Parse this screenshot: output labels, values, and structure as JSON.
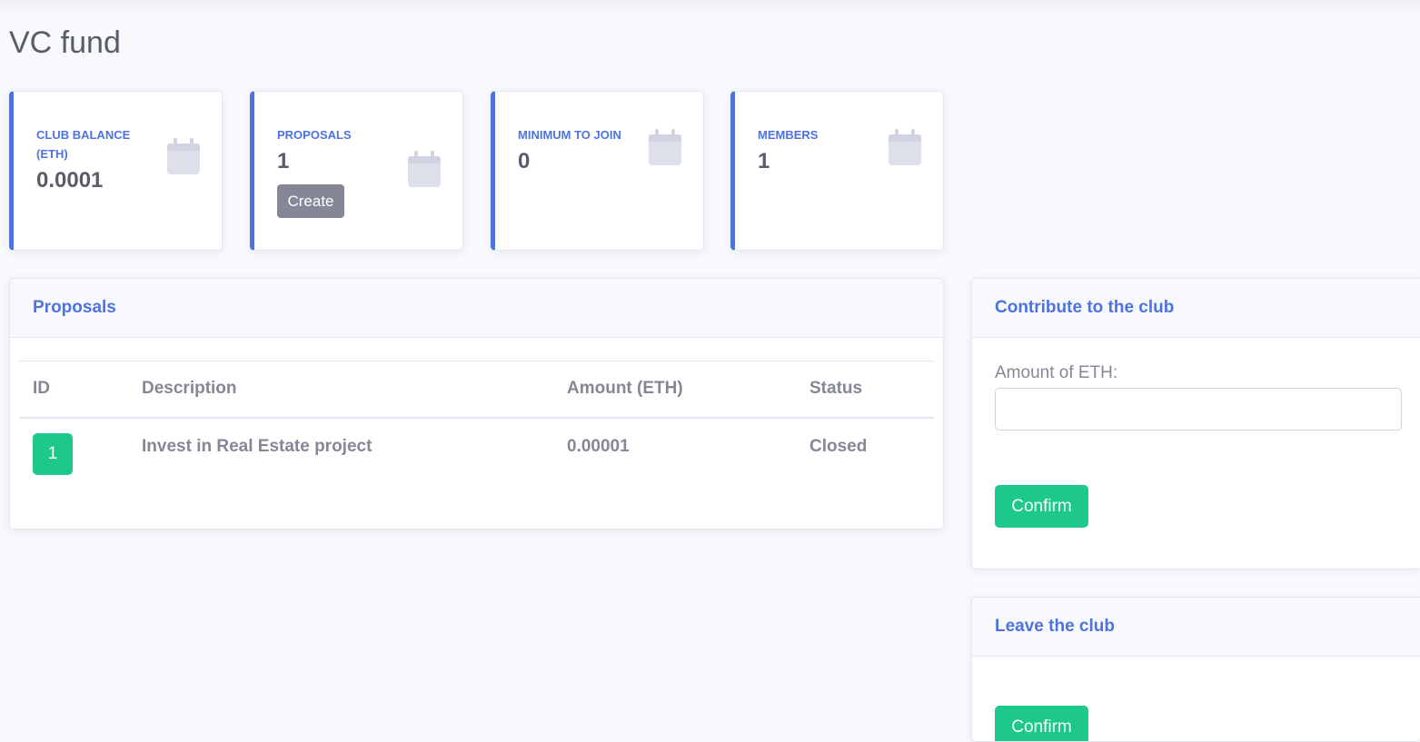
{
  "page": {
    "title": "VC fund"
  },
  "stats": [
    {
      "label": "Club Balance (ETH)",
      "value": "0.0001",
      "icon": "calendar-icon"
    },
    {
      "label": "Proposals",
      "value": "1",
      "button": "Create",
      "icon": "calendar-icon"
    },
    {
      "label": "Minimum to join",
      "value": "0",
      "icon": "calendar-icon"
    },
    {
      "label": "Members",
      "value": "1",
      "icon": "calendar-icon"
    }
  ],
  "proposals": {
    "title": "Proposals",
    "columns": [
      "ID",
      "Description",
      "Amount (ETH)",
      "Status"
    ],
    "rows": [
      {
        "id": "1",
        "description": "Invest in Real Estate project",
        "amount": "0.00001",
        "status": "Closed"
      }
    ]
  },
  "contribute": {
    "title": "Contribute to the club",
    "label": "Amount of ETH:",
    "value": "",
    "button": "Confirm"
  },
  "leave": {
    "title": "Leave the club",
    "button": "Confirm"
  },
  "colors": {
    "primary": "#4e73df",
    "success": "#1cc88a",
    "secondary": "#858796",
    "text_dark": "#5a5c69",
    "icon": "#dddfeb"
  }
}
